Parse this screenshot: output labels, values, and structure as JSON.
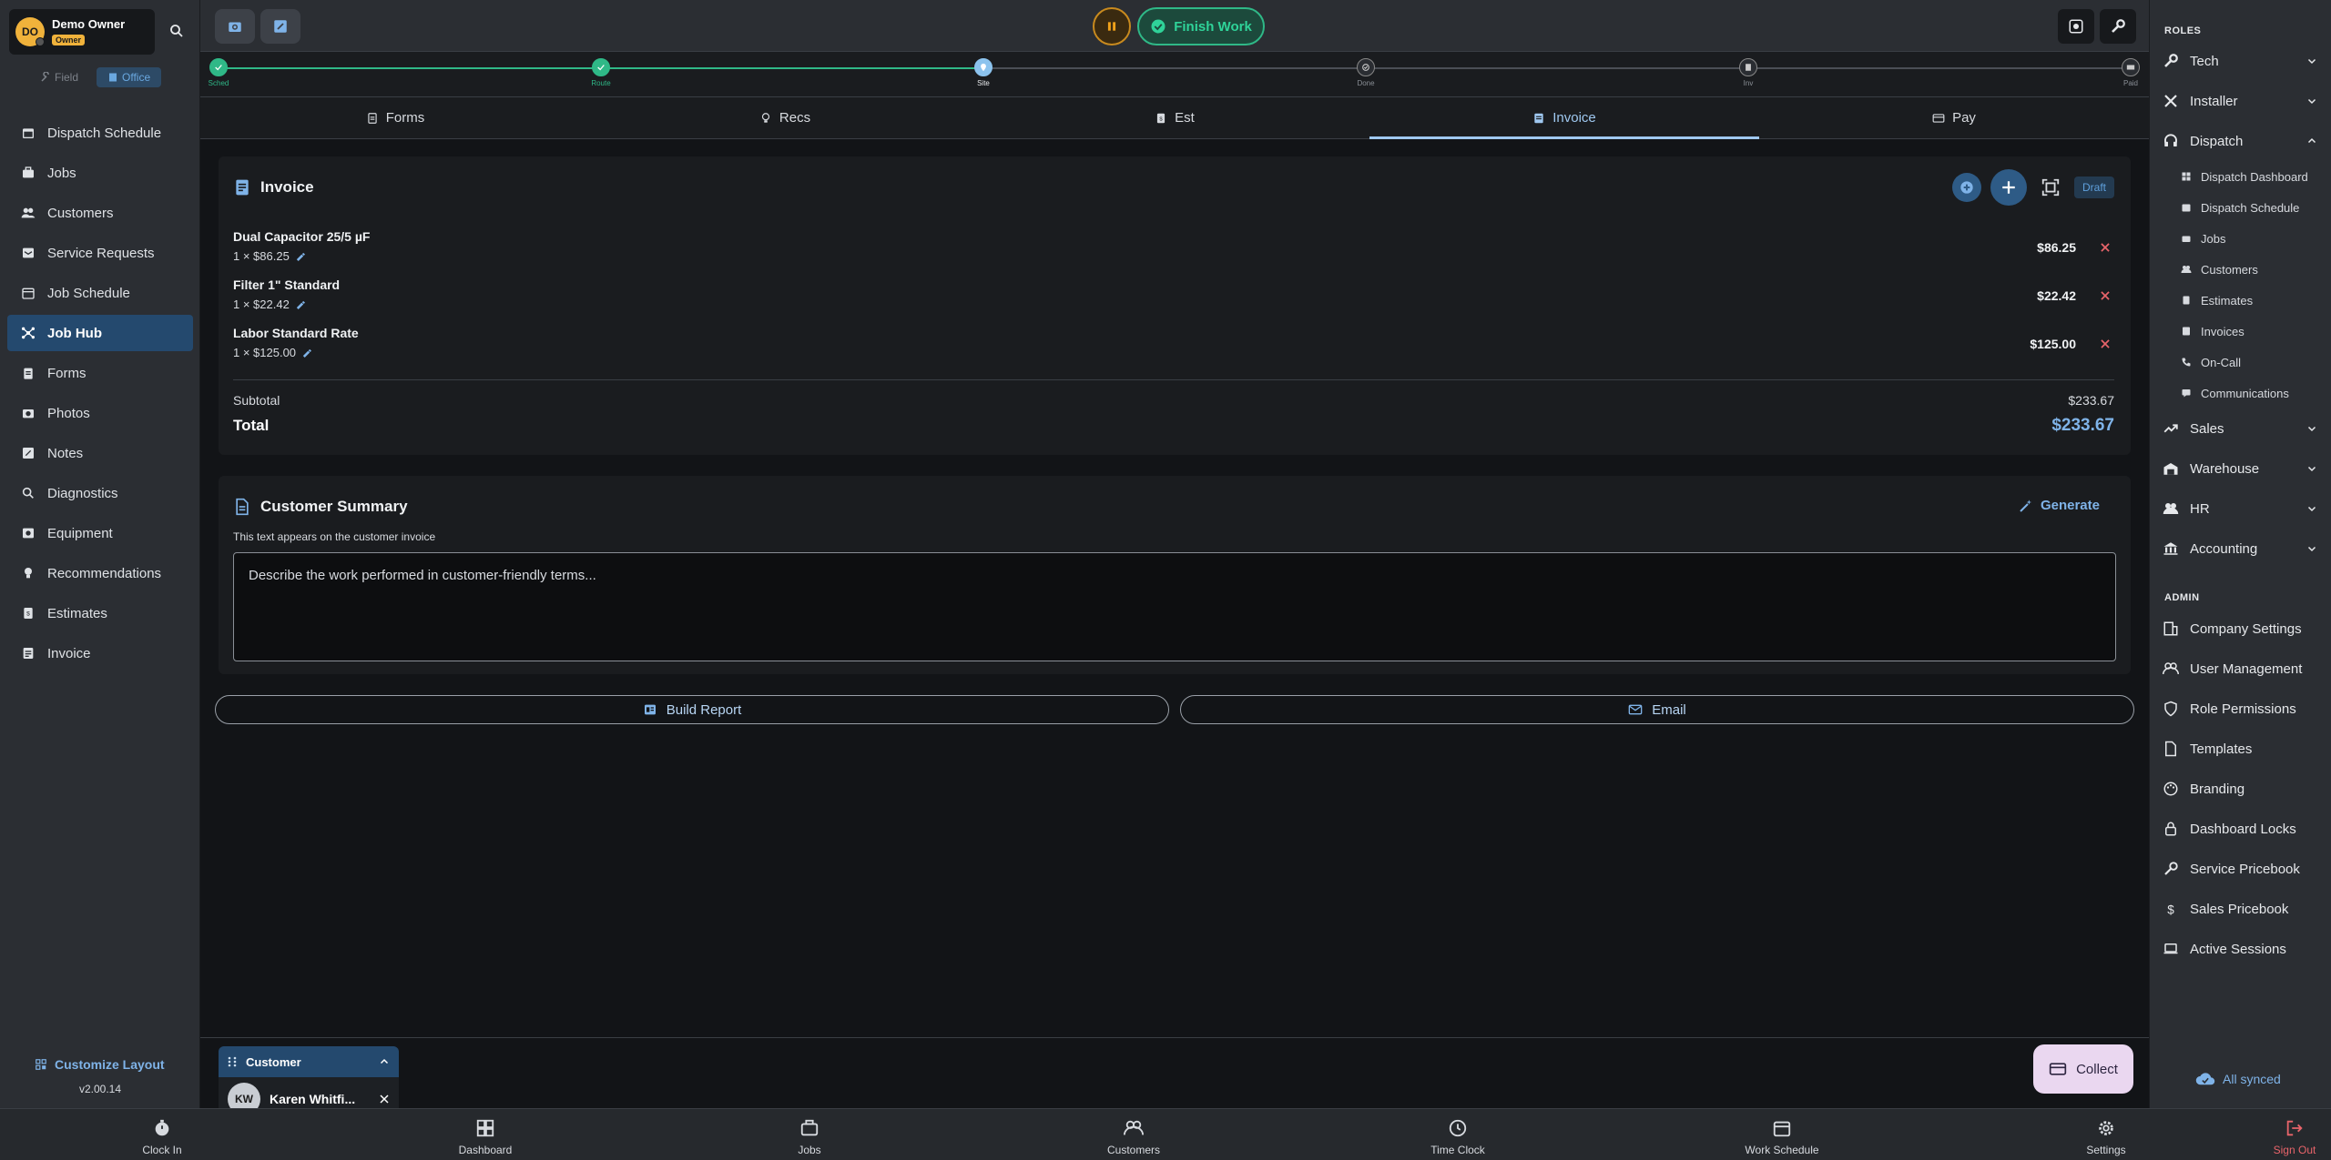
{
  "user": {
    "initials": "DO",
    "name": "Demo Owner",
    "role_badge": "Owner"
  },
  "mode_toggle": {
    "field": "Field",
    "office": "Office"
  },
  "left_nav": [
    {
      "label": "Dispatch Schedule",
      "icon": "calendar-icon"
    },
    {
      "label": "Jobs",
      "icon": "briefcase-icon"
    },
    {
      "label": "Customers",
      "icon": "people-icon"
    },
    {
      "label": "Service Requests",
      "icon": "inbox-icon"
    },
    {
      "label": "Job Schedule",
      "icon": "calendar-icon"
    },
    {
      "label": "Job Hub",
      "icon": "hub-icon"
    },
    {
      "label": "Forms",
      "icon": "clipboard-icon"
    },
    {
      "label": "Photos",
      "icon": "camera-icon"
    },
    {
      "label": "Notes",
      "icon": "note-icon"
    },
    {
      "label": "Diagnostics",
      "icon": "search-icon"
    },
    {
      "label": "Equipment",
      "icon": "equipment-icon"
    },
    {
      "label": "Recommendations",
      "icon": "lightbulb-icon"
    },
    {
      "label": "Estimates",
      "icon": "estimate-icon"
    },
    {
      "label": "Invoice",
      "icon": "invoice-icon"
    }
  ],
  "customize_layout": "Customize Layout",
  "version": "v2.00.14",
  "topbar": {
    "finish_work": "Finish Work"
  },
  "progress_steps": [
    {
      "label": "Sched",
      "state": "done"
    },
    {
      "label": "Route",
      "state": "done"
    },
    {
      "label": "Site",
      "state": "current"
    },
    {
      "label": "Done",
      "state": "pending"
    },
    {
      "label": "Inv",
      "state": "pending"
    },
    {
      "label": "Paid",
      "state": "pending"
    }
  ],
  "tabs": [
    {
      "label": "Forms",
      "icon": "document-icon"
    },
    {
      "label": "Recs",
      "icon": "lightbulb-icon"
    },
    {
      "label": "Est",
      "icon": "estimate-icon"
    },
    {
      "label": "Invoice",
      "icon": "invoice-icon",
      "active": true
    },
    {
      "label": "Pay",
      "icon": "card-icon"
    }
  ],
  "invoice": {
    "title": "Invoice",
    "status": "Draft",
    "items": [
      {
        "name": "Dual Capacitor 25/5 µF",
        "qty_line": "1 × $86.25",
        "price": "$86.25"
      },
      {
        "name": "Filter 1\" Standard",
        "qty_line": "1 × $22.42",
        "price": "$22.42"
      },
      {
        "name": "Labor Standard Rate",
        "qty_line": "1 × $125.00",
        "price": "$125.00"
      }
    ],
    "subtotal_label": "Subtotal",
    "subtotal": "$233.67",
    "total_label": "Total",
    "total": "$233.67"
  },
  "summary": {
    "title": "Customer Summary",
    "generate": "Generate",
    "subtitle": "This text appears on the customer invoice",
    "placeholder": "Describe the work performed in customer-friendly terms..."
  },
  "actions": {
    "build_report": "Build Report",
    "email": "Email"
  },
  "customer_widget": {
    "title": "Customer",
    "initials": "KW",
    "name": "Karen Whitfi..."
  },
  "collect": "Collect",
  "right_sidebar": {
    "roles_head": "ROLES",
    "roles": [
      "Tech",
      "Installer",
      "Dispatch",
      "Sales",
      "Warehouse",
      "HR",
      "Accounting"
    ],
    "dispatch_sub": [
      "Dispatch Dashboard",
      "Dispatch Schedule",
      "Jobs",
      "Customers",
      "Estimates",
      "Invoices",
      "On-Call",
      "Communications"
    ],
    "admin_head": "ADMIN",
    "admin": [
      "Company Settings",
      "User Management",
      "Role Permissions",
      "Templates",
      "Branding",
      "Dashboard Locks",
      "Service Pricebook",
      "Sales Pricebook",
      "Active Sessions"
    ],
    "synced": "All synced"
  },
  "bottom_nav": [
    {
      "label": "Clock In",
      "icon": "stopwatch-icon"
    },
    {
      "label": "Dashboard",
      "icon": "dashboard-icon"
    },
    {
      "label": "Jobs",
      "icon": "briefcase-icon"
    },
    {
      "label": "Customers",
      "icon": "people-icon"
    },
    {
      "label": "Time Clock",
      "icon": "clock-icon"
    },
    {
      "label": "Work Schedule",
      "icon": "calendar-icon"
    },
    {
      "label": "Settings",
      "icon": "gear-icon"
    },
    {
      "label": "Sign Out",
      "icon": "signout-icon"
    }
  ],
  "colors": {
    "accent": "#7fb3e8",
    "success": "#2fb887",
    "warning": "#f0b23b",
    "danger": "#e8646a"
  }
}
